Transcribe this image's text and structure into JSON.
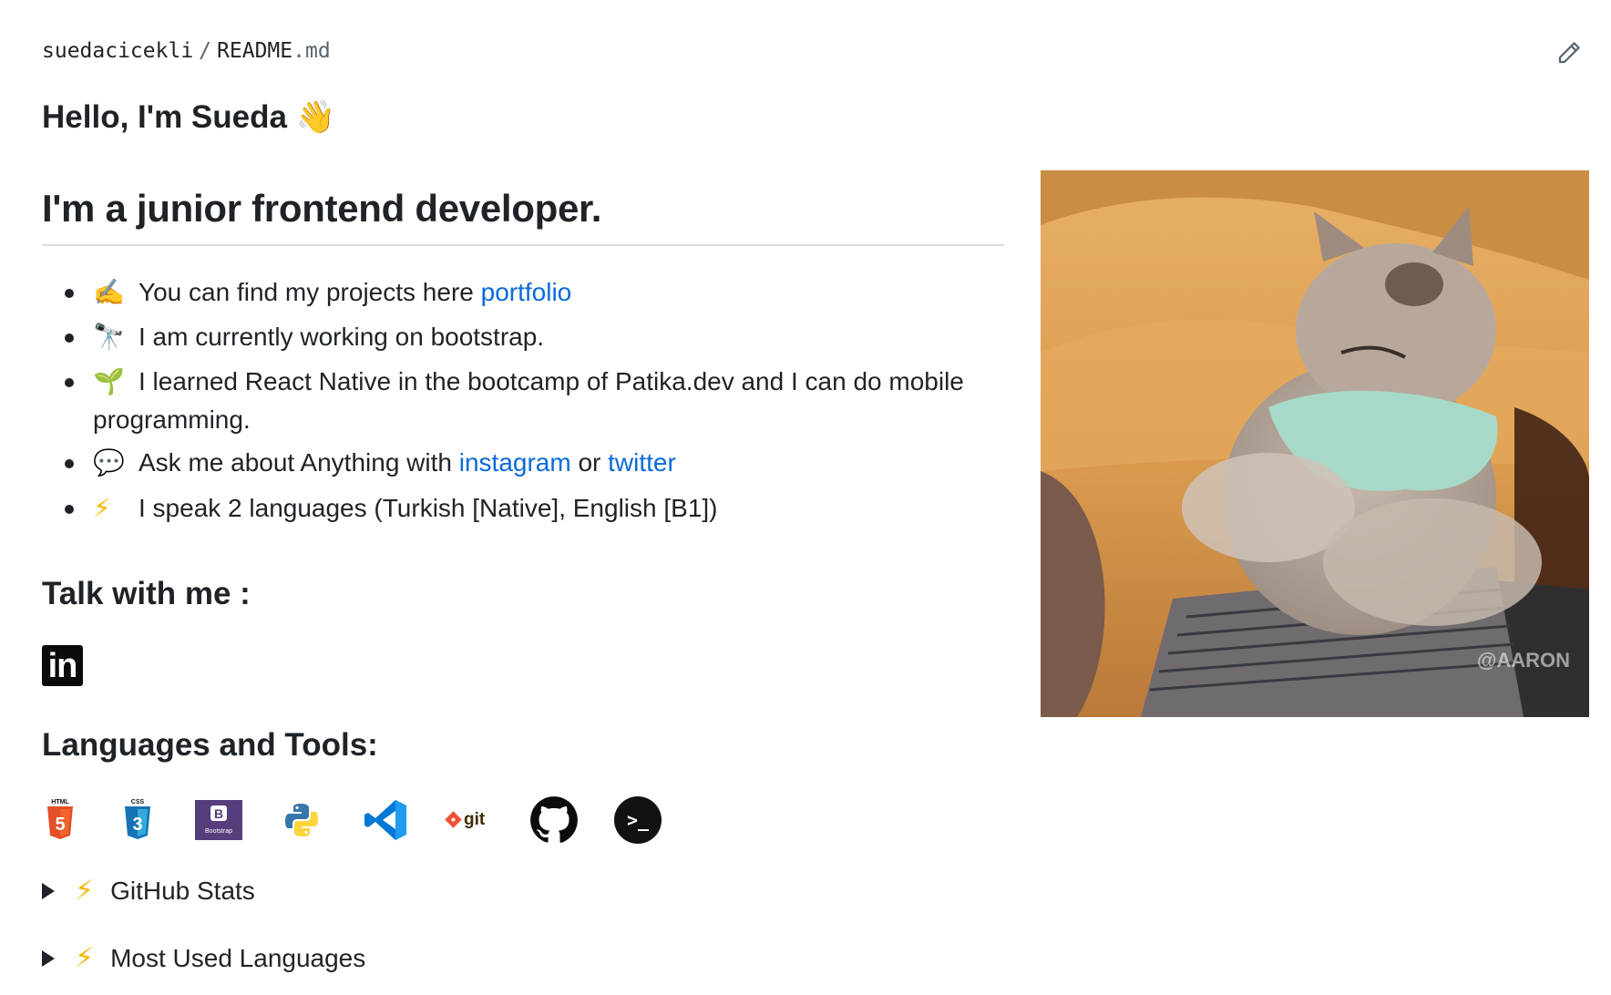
{
  "breadcrumb": {
    "owner": "suedacicekli",
    "separator": "/",
    "file_base": "README",
    "file_ext": ".md"
  },
  "title": {
    "text": "Hello, I'm Sueda",
    "emoji": "👋"
  },
  "subtitle": "I'm a junior frontend developer.",
  "bullets": [
    {
      "emoji": "✍️",
      "text": "You can find my projects here ",
      "link": "portfolio"
    },
    {
      "emoji": "🔭",
      "text": "I am currently working on bootstrap."
    },
    {
      "emoji": "🌱",
      "text": "I learned React Native in the bootcamp of Patika.dev and I can do mobile programming."
    },
    {
      "emoji": "💬",
      "text": "Ask me about Anything with ",
      "link1": "instagram",
      "middle": " or ",
      "link2": "twitter"
    },
    {
      "emoji": "⚡",
      "text": "I speak 2 languages (Turkish [Native], English [B1])"
    }
  ],
  "talk_heading": "Talk with me :",
  "linkedin_logo": "in",
  "languages_heading": "Languages and Tools:",
  "tools": {
    "html_label": "HTML",
    "html_num": "5",
    "css_label": "CSS",
    "css_num": "3",
    "bootstrap_letter": "B",
    "bootstrap_label": "Bootstrap",
    "git_label": "git",
    "terminal_prompt": ">_"
  },
  "details": [
    {
      "icon": "⚡",
      "label": "GitHub Stats"
    },
    {
      "icon": "⚡",
      "label": "Most Used Languages"
    }
  ],
  "gif_watermark": "@AARON",
  "colors": {
    "link": "#0969da",
    "heading": "#1f2328",
    "rule": "#d8dee4",
    "bolt": "#f5b800"
  }
}
